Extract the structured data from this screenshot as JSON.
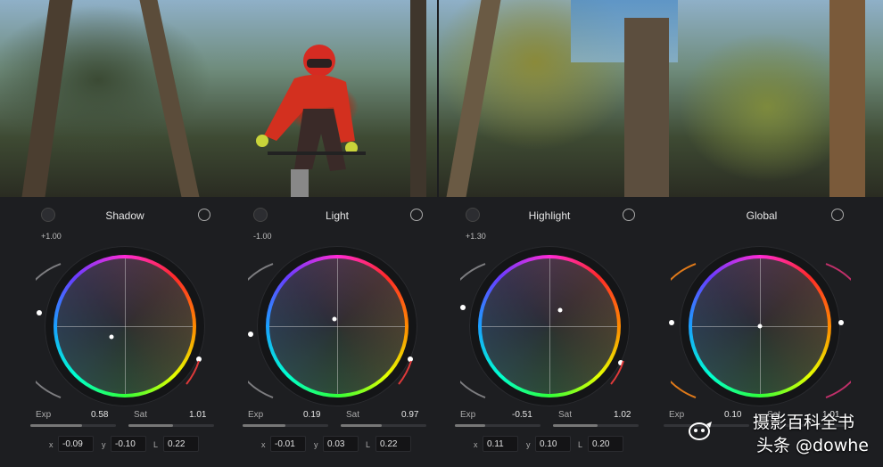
{
  "wheels": [
    {
      "title": "Shadow",
      "knob_value": "+1.00",
      "exp_label": "Exp",
      "exp_value": "0.58",
      "sat_label": "Sat",
      "sat_value": "1.01",
      "x_label": "x",
      "x_value": "-0.09",
      "y_label": "y",
      "y_value": "-0.10",
      "l_label": "L",
      "l_value": "0.22"
    },
    {
      "title": "Light",
      "knob_value": "-1.00",
      "exp_label": "Exp",
      "exp_value": "0.19",
      "sat_label": "Sat",
      "sat_value": "0.97",
      "x_label": "x",
      "x_value": "-0.01",
      "y_label": "y",
      "y_value": "0.03",
      "l_label": "L",
      "l_value": "0.22"
    },
    {
      "title": "Highlight",
      "knob_value": "+1.30",
      "exp_label": "Exp",
      "exp_value": "-0.51",
      "sat_label": "Sat",
      "sat_value": "1.02",
      "x_label": "x",
      "x_value": "0.11",
      "y_label": "y",
      "y_value": "0.10",
      "l_label": "L",
      "l_value": "0.20"
    },
    {
      "title": "Global",
      "exp_label": "Exp",
      "exp_value": "0.10",
      "sat_label": "Sat",
      "sat_value": "1.01"
    }
  ],
  "watermark": {
    "line1": "摄影百科全书",
    "line2": "头条 @dowhe"
  },
  "icons": {
    "reset": "reset-icon",
    "knob": "knob-icon",
    "logo": "watermark-logo-icon"
  }
}
